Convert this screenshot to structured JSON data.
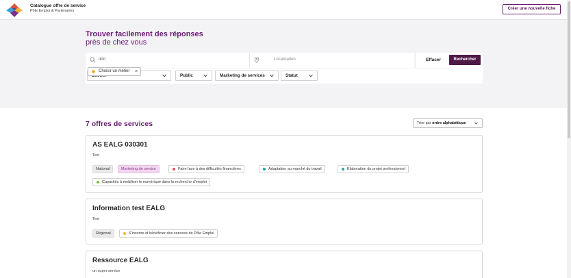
{
  "header": {
    "brand_title": "Catalogue offre de service",
    "brand_subtitle": "Pôle Emploi & Partenaires",
    "create_button": "Créer une nouvelle fiche"
  },
  "hero": {
    "title": "Trouver facilement des réponses",
    "subtitle": "près de chez vous"
  },
  "search": {
    "query_value": "ddd",
    "location_placeholder": "Localisation",
    "clear_label": "Effacer",
    "search_label": "Rechercher"
  },
  "filters": [
    {
      "label": "Besoin"
    },
    {
      "label": "Public"
    },
    {
      "label": "Marketing de services"
    },
    {
      "label": "Statut"
    }
  ],
  "active_chip": {
    "label": "Choisir un métier",
    "dot_color": "#f2b134"
  },
  "results": {
    "title": "7 offres de services",
    "sort_prefix": "Trier par",
    "sort_value": "ordre alphabétique"
  },
  "cards": [
    {
      "title": "AS EALG 030301",
      "description": "Test",
      "tags": [
        {
          "label": "National",
          "style": "grey"
        },
        {
          "label": "Marketing de service",
          "style": "pink"
        },
        {
          "label": "Faire face à des difficultés financières",
          "dot": "#e24b5b"
        },
        {
          "label": "Adaptation au marché du travail",
          "dot": "#17a8a0"
        },
        {
          "label": "Elaboration du projet professionnel",
          "dot": "#17a8a0"
        },
        {
          "label": "Capacités à mobiliser le numérique dans la recherche d'emploi",
          "dot": "#7bbf3a"
        }
      ]
    },
    {
      "title": "Information test EALG",
      "description": "Test",
      "tags": [
        {
          "label": "Régional",
          "style": "grey"
        },
        {
          "label": "S'inscrire et bénéficier des services de Pôle Emploi",
          "dot": "#f2b134"
        }
      ]
    },
    {
      "title": "Ressource EALG",
      "description": "un super service",
      "tags": []
    }
  ]
}
